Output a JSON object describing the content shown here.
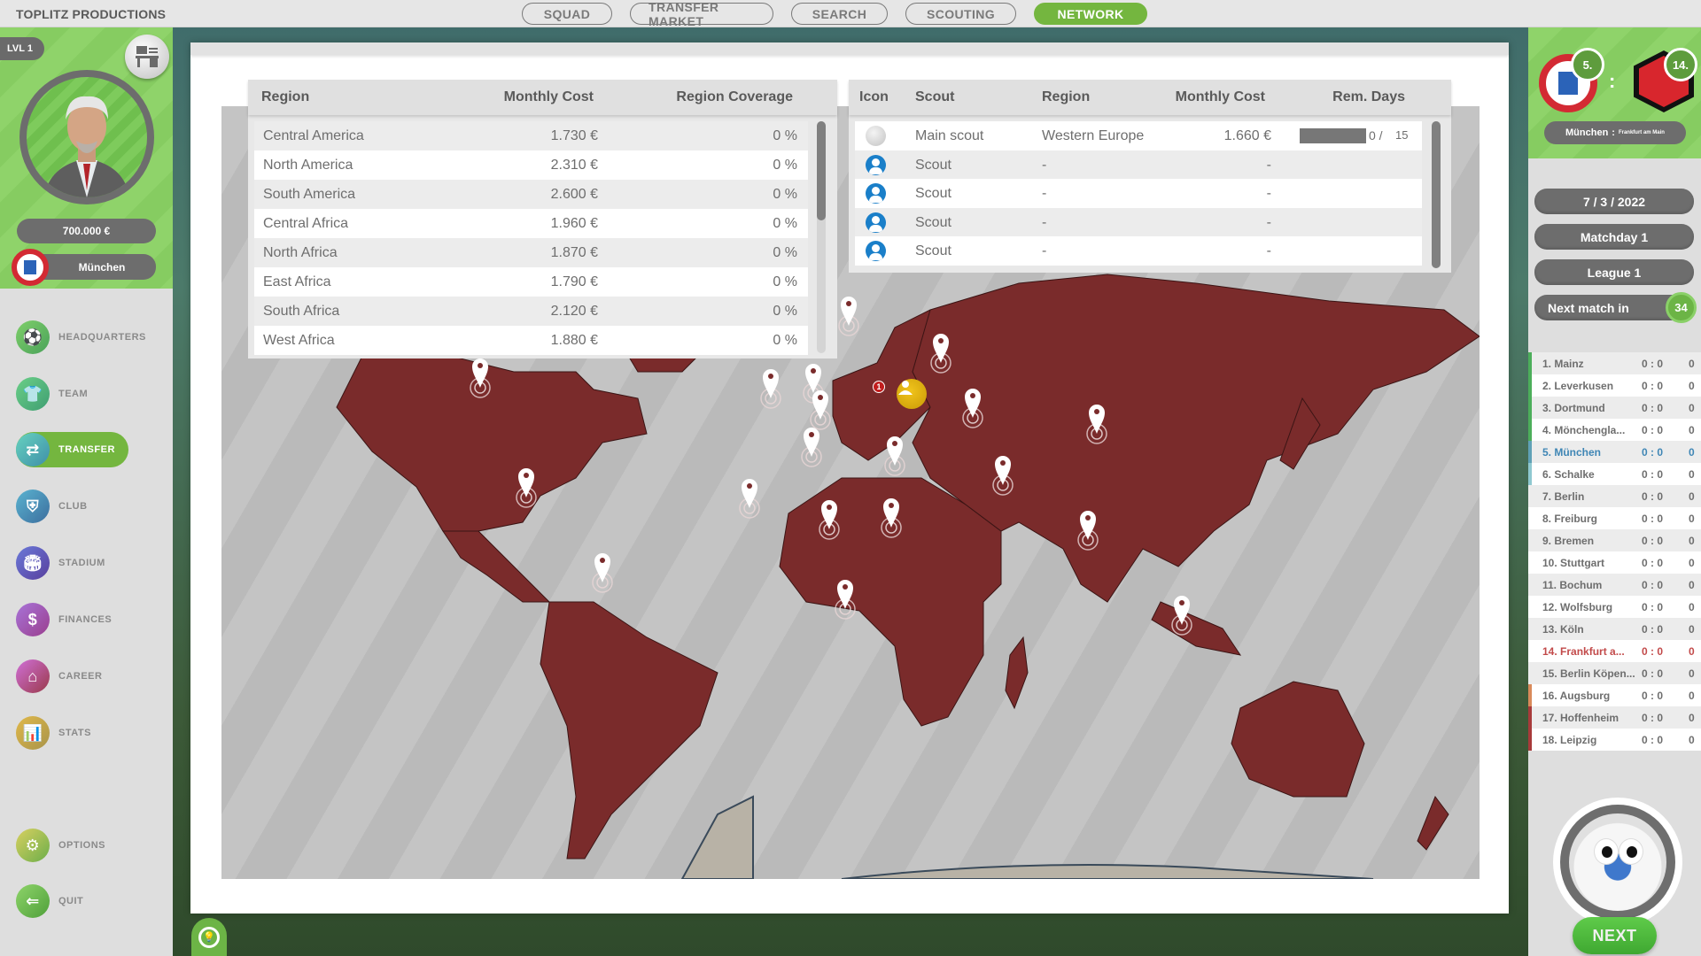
{
  "app": {
    "brand": "TOPLITZ PRODUCTIONS"
  },
  "top_tabs": [
    {
      "label": "SQUAD",
      "active": false
    },
    {
      "label": "TRANSFER MARKET",
      "active": false
    },
    {
      "label": "SEARCH",
      "active": false
    },
    {
      "label": "SCOUTING",
      "active": false
    },
    {
      "label": "NETWORK",
      "active": true
    }
  ],
  "profile": {
    "level": "LVL 1",
    "desk_icon": "office-desk-icon",
    "money": "700.000 €",
    "club": "München"
  },
  "sidebar": {
    "items": [
      {
        "label": "HEADQUARTERS",
        "icon": "soccer-ball-icon",
        "color": "#5fb860",
        "active": false
      },
      {
        "label": "TEAM",
        "icon": "shirts-icon",
        "color": "#4fb07a",
        "active": false
      },
      {
        "label": "TRANSFER",
        "icon": "transfer-shirts-icon",
        "color": "#4ab3ad",
        "active": true
      },
      {
        "label": "CLUB",
        "icon": "club-crest-icon",
        "color": "#4a93b8",
        "active": false
      },
      {
        "label": "STADIUM",
        "icon": "stadium-icon",
        "color": "#5a5fb8",
        "active": false
      },
      {
        "label": "FINANCES",
        "icon": "money-icon",
        "color": "#8a55b0",
        "active": false
      },
      {
        "label": "CAREER",
        "icon": "home-career-icon",
        "color": "#b04a9a",
        "active": false
      },
      {
        "label": "STATS",
        "icon": "stats-chart-icon",
        "color": "#c8a640",
        "active": false
      }
    ],
    "bottom_items": [
      {
        "label": "OPTIONS",
        "icon": "gear-icon",
        "color": "#a9b73e"
      },
      {
        "label": "QUIT",
        "icon": "arrow-left-icon",
        "color": "#6cb446"
      }
    ]
  },
  "region_table": {
    "headers": {
      "region": "Region",
      "monthly_cost": "Monthly Cost",
      "coverage": "Region Coverage"
    },
    "rows": [
      {
        "region": "Central America",
        "monthly_cost": "1.730 €",
        "coverage": "0 %"
      },
      {
        "region": "North America",
        "monthly_cost": "2.310 €",
        "coverage": "0 %"
      },
      {
        "region": "South America",
        "monthly_cost": "2.600 €",
        "coverage": "0 %"
      },
      {
        "region": "Central Africa",
        "monthly_cost": "1.960 €",
        "coverage": "0 %"
      },
      {
        "region": "North Africa",
        "monthly_cost": "1.870 €",
        "coverage": "0 %"
      },
      {
        "region": "East Africa",
        "monthly_cost": "1.790 €",
        "coverage": "0 %"
      },
      {
        "region": "South Africa",
        "monthly_cost": "2.120 €",
        "coverage": "0 %"
      },
      {
        "region": "West Africa",
        "monthly_cost": "1.880 €",
        "coverage": "0 %"
      }
    ]
  },
  "scout_table": {
    "headers": {
      "icon": "Icon",
      "scout": "Scout",
      "region": "Region",
      "monthly_cost": "Monthly Cost",
      "rem_days": "Rem. Days"
    },
    "rows": [
      {
        "icon": "main-scout-icon",
        "scout": "Main scout",
        "region": "Western Europe",
        "monthly_cost": "1.660 €",
        "rem_days": "0 /",
        "rem_total": "15",
        "progress": 0
      },
      {
        "icon": "scout-user-icon",
        "scout": "Scout",
        "region": "-",
        "monthly_cost": "-",
        "rem_days": "",
        "rem_total": ""
      },
      {
        "icon": "scout-user-icon",
        "scout": "Scout",
        "region": "-",
        "monthly_cost": "-",
        "rem_days": "",
        "rem_total": ""
      },
      {
        "icon": "scout-user-icon",
        "scout": "Scout",
        "region": "-",
        "monthly_cost": "-",
        "rem_days": "",
        "rem_total": ""
      },
      {
        "icon": "scout-user-icon",
        "scout": "Scout",
        "region": "-",
        "monthly_cost": "-",
        "rem_days": "",
        "rem_total": ""
      }
    ]
  },
  "map": {
    "land_color": "#7a2b2b",
    "markers": [
      {
        "region": "North America"
      },
      {
        "region": "Central America"
      },
      {
        "region": "South America"
      },
      {
        "region": "Western Europe"
      },
      {
        "region": "Northern Europe"
      },
      {
        "region": "Central Europe"
      },
      {
        "region": "Southern Europe"
      },
      {
        "region": "Eastern Europe"
      },
      {
        "region": "North Africa"
      },
      {
        "region": "West Africa"
      },
      {
        "region": "Central Africa"
      },
      {
        "region": "East Africa"
      },
      {
        "region": "South Africa"
      },
      {
        "region": "Middle East"
      },
      {
        "region": "Central Asia"
      },
      {
        "region": "South Asia"
      },
      {
        "region": "East Asia"
      },
      {
        "region": "Southeast Asia"
      },
      {
        "region": "Oceania"
      }
    ],
    "assigned_scout_badge": "1"
  },
  "match": {
    "home_rank": "5.",
    "away_rank": "14.",
    "home_team": "München",
    "separator": ":",
    "away_team": "Frankfurt am Main",
    "date": "7 / 3 / 2022",
    "matchday": "Matchday 1",
    "league": "League 1",
    "next_match_label": "Next match in",
    "next_match_days": "34"
  },
  "standings": [
    {
      "name": "1. Mainz",
      "score": "0 : 0",
      "pts": "0",
      "zone": "cl"
    },
    {
      "name": "2. Leverkusen",
      "score": "0 : 0",
      "pts": "0",
      "zone": "cl"
    },
    {
      "name": "3. Dortmund",
      "score": "0 : 0",
      "pts": "0",
      "zone": "cl"
    },
    {
      "name": "4. Mönchengla...",
      "score": "0 : 0",
      "pts": "0",
      "zone": "cl"
    },
    {
      "name": "5. München",
      "score": "0 : 0",
      "pts": "0",
      "zone": "el",
      "highlight": "home"
    },
    {
      "name": "6. Schalke",
      "score": "0 : 0",
      "pts": "0",
      "zone": "ecl"
    },
    {
      "name": "7. Berlin",
      "score": "0 : 0",
      "pts": "0"
    },
    {
      "name": "8. Freiburg",
      "score": "0 : 0",
      "pts": "0"
    },
    {
      "name": "9. Bremen",
      "score": "0 : 0",
      "pts": "0"
    },
    {
      "name": "10. Stuttgart",
      "score": "0 : 0",
      "pts": "0"
    },
    {
      "name": "11. Bochum",
      "score": "0 : 0",
      "pts": "0"
    },
    {
      "name": "12. Wolfsburg",
      "score": "0 : 0",
      "pts": "0"
    },
    {
      "name": "13. Köln",
      "score": "0 : 0",
      "pts": "0"
    },
    {
      "name": "14. Frankfurt a...",
      "score": "0 : 0",
      "pts": "0",
      "highlight": "away"
    },
    {
      "name": "15. Berlin Köpen...",
      "score": "0 : 0",
      "pts": "0"
    },
    {
      "name": "16. Augsburg",
      "score": "0 : 0",
      "pts": "0",
      "zone": "po"
    },
    {
      "name": "17. Hoffenheim",
      "score": "0 : 0",
      "pts": "0",
      "zone": "rel"
    },
    {
      "name": "18. Leipzig",
      "score": "0 : 0",
      "pts": "0",
      "zone": "rel"
    }
  ],
  "next_button": "NEXT"
}
